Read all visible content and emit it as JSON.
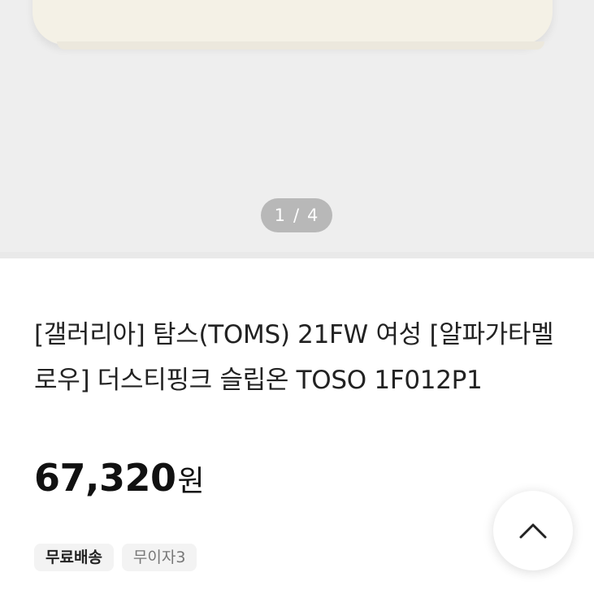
{
  "gallery": {
    "current": "1",
    "separator": "/",
    "total": "4"
  },
  "product": {
    "title": "[갤러리아] 탐스(TOMS) 21FW 여성 [알파가타멜로우] 더스티핑크 슬립온 TOSO 1F012P1",
    "price": "67,320",
    "currency": "원"
  },
  "tags": [
    {
      "label": "무료배송"
    },
    {
      "label": "무이자3"
    }
  ],
  "scroll_top": {
    "icon": "chevron-up-icon"
  },
  "colors": {
    "image_background": "#eeeeee",
    "pager_background": "#8c8c8c",
    "tag_background": "#f3f3f3",
    "text_primary": "#222222",
    "text_muted": "#777777"
  }
}
